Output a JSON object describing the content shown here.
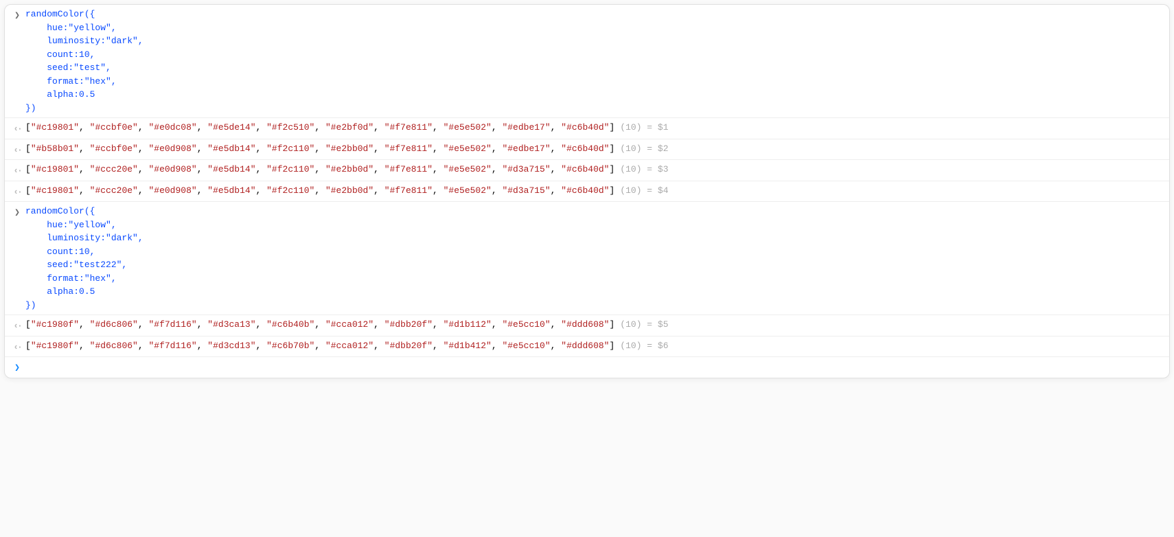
{
  "entries": [
    {
      "type": "input",
      "code": "randomColor({\n    hue:\"yellow\",\n    luminosity:\"dark\",\n    count:10,\n    seed:\"test\",\n    format:\"hex\",\n    alpha:0.5\n})"
    },
    {
      "type": "output",
      "array": [
        "#c19801",
        "#ccbf0e",
        "#e0dc08",
        "#e5de14",
        "#f2c510",
        "#e2bf0d",
        "#f7e811",
        "#e5e502",
        "#edbe17",
        "#c6b40d"
      ],
      "count": 10,
      "var": "$1"
    },
    {
      "type": "output",
      "array": [
        "#b58b01",
        "#ccbf0e",
        "#e0d908",
        "#e5db14",
        "#f2c110",
        "#e2bb0d",
        "#f7e811",
        "#e5e502",
        "#edbe17",
        "#c6b40d"
      ],
      "count": 10,
      "var": "$2"
    },
    {
      "type": "output",
      "array": [
        "#c19801",
        "#ccc20e",
        "#e0d908",
        "#e5db14",
        "#f2c110",
        "#e2bb0d",
        "#f7e811",
        "#e5e502",
        "#d3a715",
        "#c6b40d"
      ],
      "count": 10,
      "var": "$3"
    },
    {
      "type": "output",
      "array": [
        "#c19801",
        "#ccc20e",
        "#e0d908",
        "#e5db14",
        "#f2c110",
        "#e2bb0d",
        "#f7e811",
        "#e5e502",
        "#d3a715",
        "#c6b40d"
      ],
      "count": 10,
      "var": "$4"
    },
    {
      "type": "input",
      "code": "randomColor({\n    hue:\"yellow\",\n    luminosity:\"dark\",\n    count:10,\n    seed:\"test222\",\n    format:\"hex\",\n    alpha:0.5\n})"
    },
    {
      "type": "output",
      "array": [
        "#c1980f",
        "#d6c806",
        "#f7d116",
        "#d3ca13",
        "#c6b40b",
        "#cca012",
        "#dbb20f",
        "#d1b112",
        "#e5cc10",
        "#ddd608"
      ],
      "count": 10,
      "var": "$5"
    },
    {
      "type": "output",
      "array": [
        "#c1980f",
        "#d6c806",
        "#f7d116",
        "#d3cd13",
        "#c6b70b",
        "#cca012",
        "#dbb20f",
        "#d1b412",
        "#e5cc10",
        "#ddd608"
      ],
      "count": 10,
      "var": "$6"
    }
  ],
  "glyphs": {
    "in": "❯",
    "out": "‹·",
    "prompt": "❯"
  },
  "meta_label_prefix": "(",
  "meta_label_suffix": ") = "
}
